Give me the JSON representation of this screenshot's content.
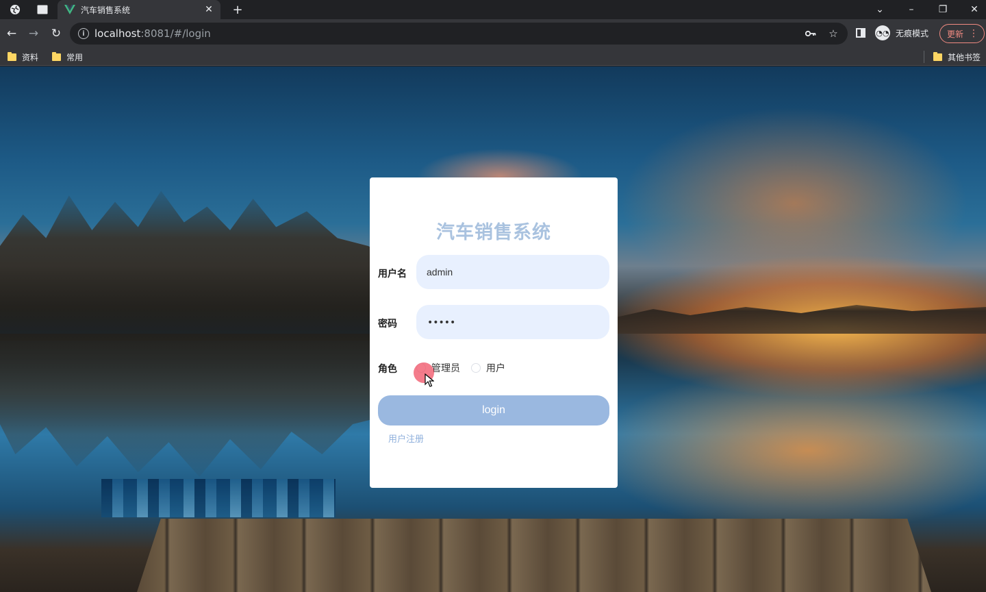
{
  "browser": {
    "tab": {
      "title": "汽车销售系统",
      "favicon": "vue-logo-icon"
    },
    "url_host": "localhost",
    "url_rest": ":8081/#/login",
    "profile_label": "无痕模式",
    "update_label": "更新",
    "bookmarks": [
      {
        "label": "资料"
      },
      {
        "label": "常用"
      }
    ],
    "other_bookmarks_label": "其他书签"
  },
  "login": {
    "title": "汽车销售系统",
    "username_label": "用户名",
    "username_value": "admin",
    "password_label": "密码",
    "password_masked": "•••••",
    "role_label": "角色",
    "roles": [
      {
        "label": "管理员",
        "selected": false
      },
      {
        "label": "用户",
        "selected": false
      }
    ],
    "login_button": "login",
    "register_link": "用户注册"
  },
  "colors": {
    "title": "#a9c2df",
    "input_bg": "#e8f0fe",
    "button_bg": "#9ab8e0",
    "link": "#8fb0dc"
  }
}
